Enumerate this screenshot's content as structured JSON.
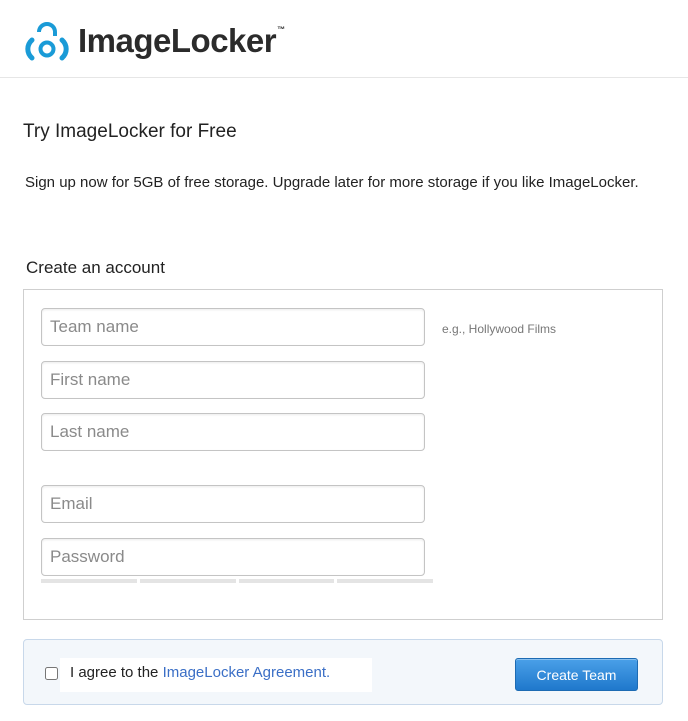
{
  "header": {
    "brand": "ImageLocker",
    "trademark": "™"
  },
  "page": {
    "title": "Try ImageLocker for Free",
    "intro": "Sign up now for 5GB of free storage.  Upgrade later for more storage if you like ImageLocker."
  },
  "form": {
    "section_title": "Create an account",
    "fields": {
      "team_name": {
        "placeholder": "Team name",
        "value": "",
        "hint": "e.g., Hollywood Films"
      },
      "first_name": {
        "placeholder": "First name",
        "value": ""
      },
      "last_name": {
        "placeholder": "Last name",
        "value": ""
      },
      "email": {
        "placeholder": "Email",
        "value": ""
      },
      "password": {
        "placeholder": "Password",
        "value": ""
      }
    }
  },
  "footer": {
    "agree_prefix": "I agree to the ",
    "agree_link": "ImageLocker Agreement.",
    "agree_checked": false,
    "submit_label": "Create Team"
  },
  "colors": {
    "brand_blue": "#1a9bd7",
    "link": "#3b6fc6",
    "button": "#1f78cc"
  },
  "icons": {
    "logo": "padlock-logo-icon"
  }
}
